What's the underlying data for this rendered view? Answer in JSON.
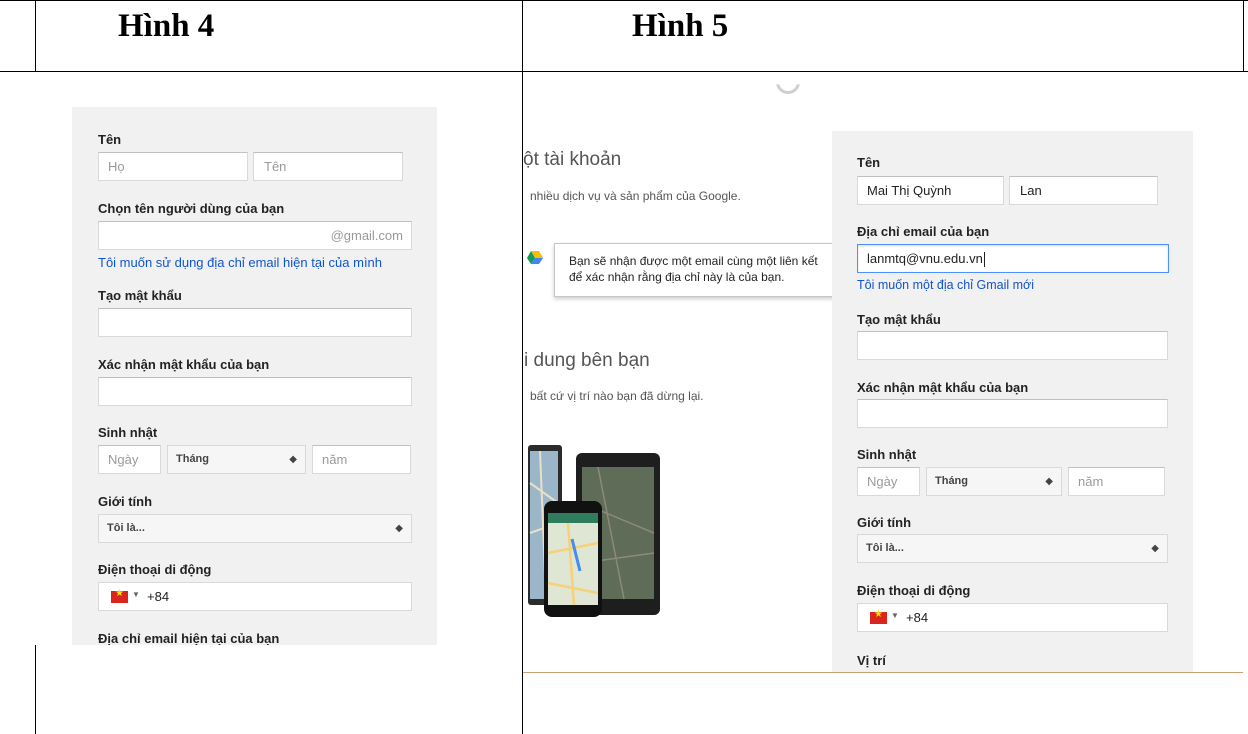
{
  "headings": {
    "left": "Hình 4",
    "right": "Hình 5"
  },
  "form4": {
    "name_label": "Tên",
    "last_name_placeholder": "Họ",
    "first_name_placeholder": "Tên",
    "username_label": "Chọn tên người dùng của bạn",
    "username_suffix": "@gmail.com",
    "use_current_email_link": "Tôi muốn sử dụng địa chỉ email hiện tại của mình",
    "password_label": "Tạo mật khẩu",
    "confirm_password_label": "Xác nhận mật khẩu của bạn",
    "birthday_label": "Sinh nhật",
    "day_placeholder": "Ngày",
    "month_value": "Tháng",
    "year_placeholder": "năm",
    "gender_label": "Giới tính",
    "gender_value": "Tôi là...",
    "phone_label": "Điện thoại di động",
    "phone_code": "+84",
    "current_email_label": "Địa chỉ email hiện tại của bạn"
  },
  "form5": {
    "name_label": "Tên",
    "last_name_value": "Mai Thị Quỳnh",
    "first_name_value": "Lan",
    "email_label": "Địa chỉ email của bạn",
    "email_value": "lanmtq@vnu.edu.vn",
    "new_gmail_link": "Tôi muốn một địa chỉ Gmail mới",
    "password_label": "Tạo mật khẩu",
    "confirm_password_label": "Xác nhận mật khẩu của bạn",
    "birthday_label": "Sinh nhật",
    "day_placeholder": "Ngày",
    "month_value": "Tháng",
    "year_placeholder": "năm",
    "gender_label": "Giới tính",
    "gender_value": "Tôi là...",
    "phone_label": "Điện thoại di động",
    "phone_code": "+84",
    "location_label": "Vị trí"
  },
  "marketing": {
    "title1": "ột tài khoản",
    "sub1": "nhiều dịch vụ và sản phẩm của Google.",
    "title2": "i dung bên bạn",
    "sub2": "bất cứ vị trí nào bạn đã dừng lại.",
    "tooltip": "Bạn sẽ nhận được một email cùng một liên kết để xác nhận rằng địa chỉ này là của bạn."
  },
  "colors": {
    "link": "#1155cc",
    "focus_border": "#4d90fe",
    "panel_bg": "#f1f1f1",
    "flag_red": "#da251d",
    "flag_star": "#ffde00"
  }
}
